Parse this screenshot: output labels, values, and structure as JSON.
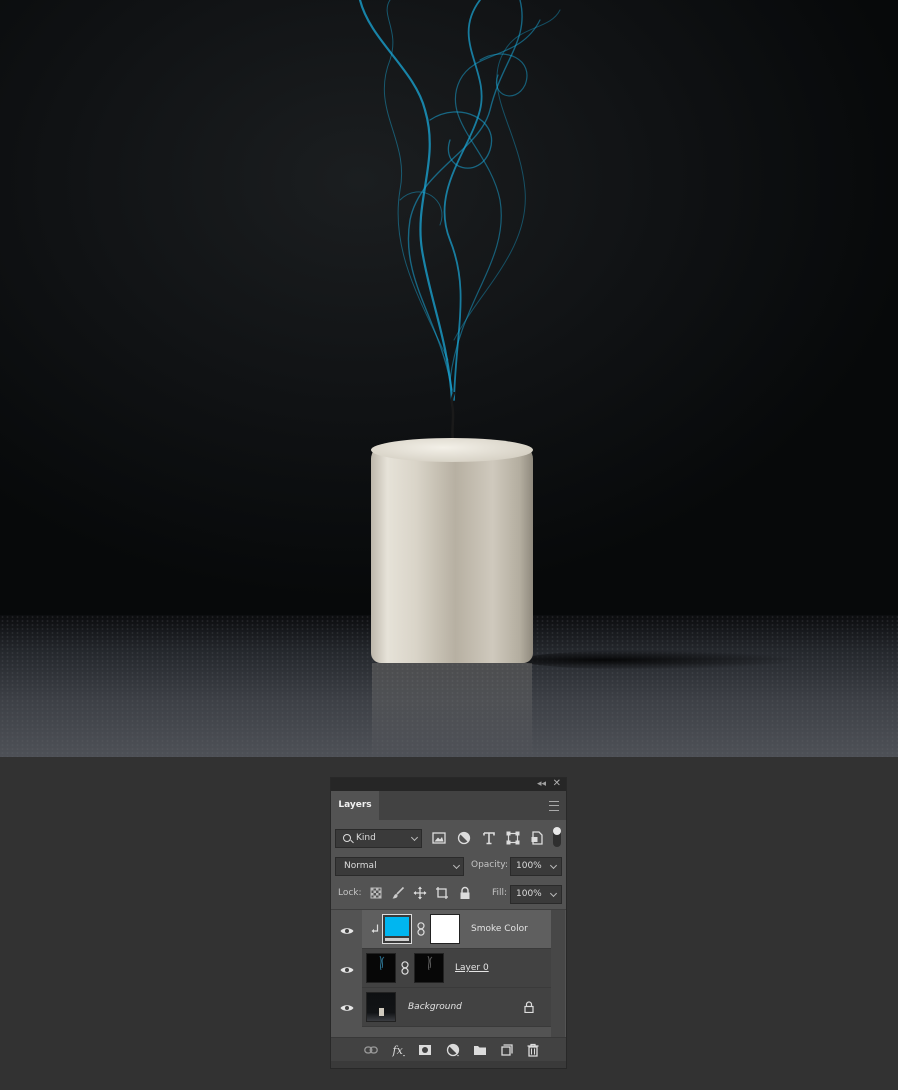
{
  "panel": {
    "tab_title": "Layers",
    "filter": {
      "kind_label": "Kind"
    },
    "blend_mode": "Normal",
    "opacity_label": "Opacity:",
    "opacity_value": "100%",
    "lock_label": "Lock:",
    "fill_label": "Fill:",
    "fill_value": "100%"
  },
  "layers": [
    {
      "name": "Smoke Color",
      "selected": true,
      "visible": true,
      "fill_color": "#00B6F0",
      "clipped": true
    },
    {
      "name": "Layer 0",
      "selected": false,
      "visible": true
    },
    {
      "name": "Background",
      "selected": false,
      "visible": true,
      "locked": true
    }
  ],
  "colors": {
    "smoke": "#1aa8d8",
    "panel_bg": "#535353",
    "workspace_bg": "#323232"
  }
}
